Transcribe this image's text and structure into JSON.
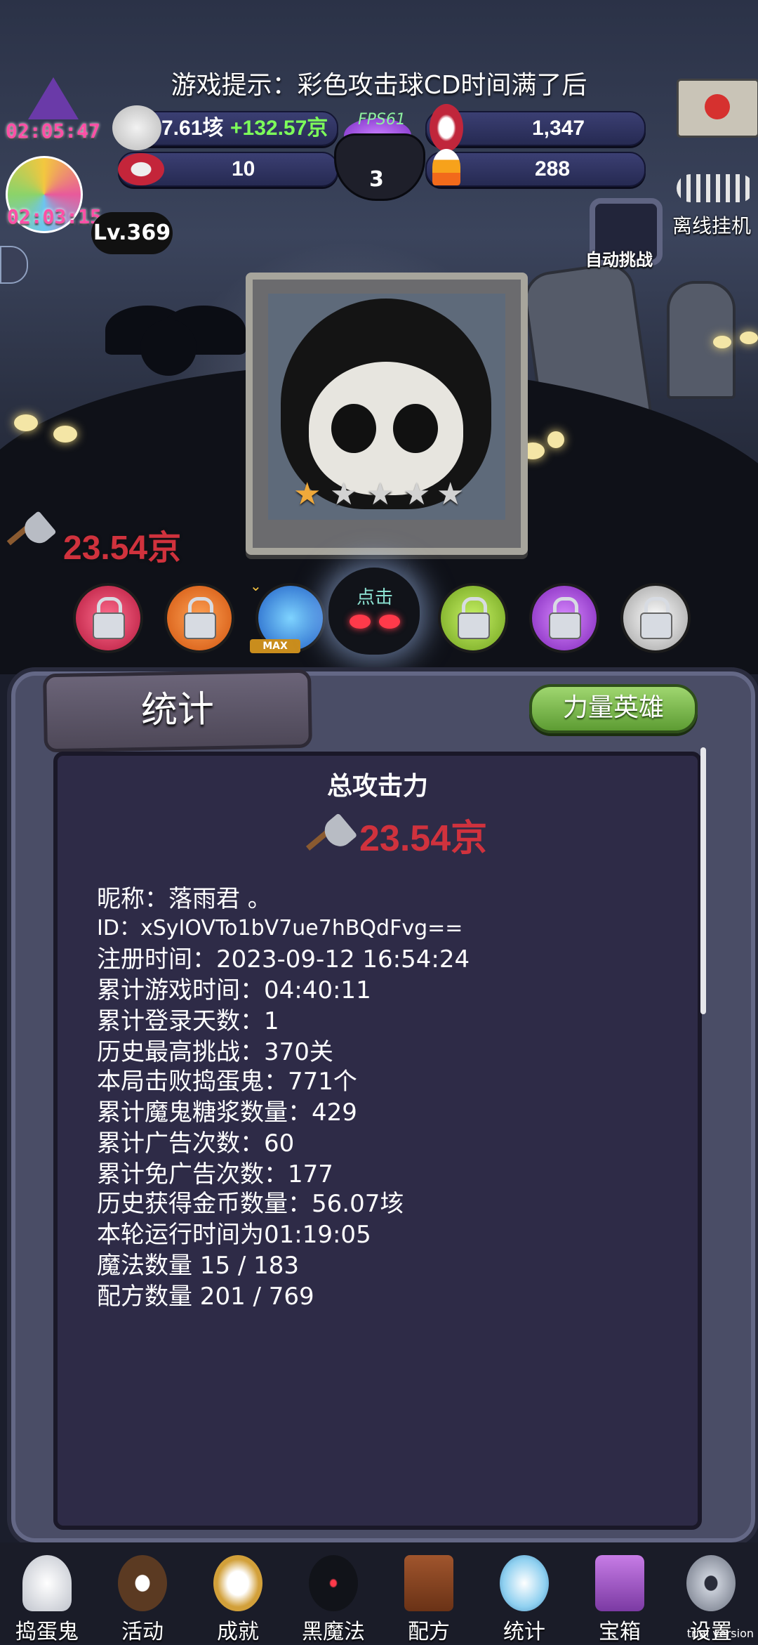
{
  "header": {
    "tip": "游戏提示：彩色攻击球CD时间满了后",
    "timer_top": "02:05:47",
    "timer_bottom": "02:03:15",
    "level": "Lv.369",
    "fps": "FPS61"
  },
  "resources": {
    "gold": "7.61垓",
    "gold_rate": "+132.57京",
    "candy_skull": "10",
    "cauldron_count": "3",
    "potion": "1,347",
    "candy_corn": "288"
  },
  "side": {
    "offline": "离线挂机",
    "auto_challenge": "自动挑战"
  },
  "attack_top": "23.54京",
  "hero_row": {
    "max_label": "MAX",
    "tap_label": "点击",
    "colors": [
      "#d6294b",
      "#e36b1b",
      "#2a70d8",
      "#8fd235",
      "#a543d8",
      "#d9d9d9"
    ]
  },
  "panel": {
    "tab": "统计",
    "hero_button": "力量英雄",
    "title": "总攻击力",
    "attack": "23.54京",
    "stats": [
      "昵称：落雨君 。",
      "ID：xSyIOVTo1bV7ue7hBQdFvg==",
      "注册时间：2023-09-12 16:54:24",
      "累计游戏时间：04:40:11",
      "累计登录天数：1",
      "历史最高挑战：370关",
      "本局击败捣蛋鬼：771个",
      "累计魔鬼糖浆数量：429",
      "累计广告次数：60",
      "累计免广告次数：177",
      "历史获得金币数量：56.07垓",
      "本轮运行时间为01:19:05",
      "魔法数量 15 / 183",
      "配方数量 201 / 769"
    ]
  },
  "nav": [
    "捣蛋鬼",
    "活动",
    "成就",
    "黑魔法",
    "配方",
    "统计",
    "宝箱",
    "设置"
  ],
  "trial": "trial version"
}
